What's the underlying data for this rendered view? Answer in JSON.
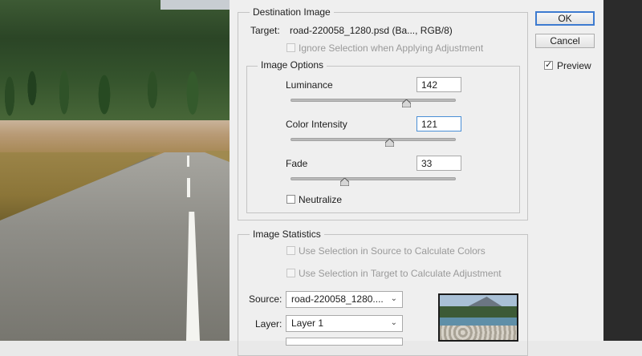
{
  "destination": {
    "group_title": "Destination Image",
    "target_label": "Target:",
    "target_value": "road-220058_1280.psd (Ba..., RGB/8)",
    "ignore_selection_label": "Ignore Selection when Applying Adjustment"
  },
  "image_options": {
    "group_title": "Image Options",
    "luminance": {
      "label": "Luminance",
      "value": "142",
      "slider_fraction": 0.7
    },
    "color_intensity": {
      "label": "Color Intensity",
      "value": "121",
      "slider_fraction": 0.6
    },
    "fade": {
      "label": "Fade",
      "value": "33",
      "slider_fraction": 0.33
    },
    "neutralize_label": "Neutralize"
  },
  "image_statistics": {
    "group_title": "Image Statistics",
    "use_source_label": "Use Selection in Source to Calculate Colors",
    "use_target_label": "Use Selection in Target to Calculate Adjustment",
    "source_label": "Source:",
    "source_value": "road-220058_1280....",
    "layer_label": "Layer:",
    "layer_value": "Layer 1"
  },
  "buttons": {
    "ok": "OK",
    "cancel": "Cancel",
    "preview_label": "Preview",
    "preview_checked": true
  },
  "icons": {
    "dropdown": "chevron-down-icon",
    "slider_thumb": "slider-triangle-icon",
    "check": "checkmark-icon"
  },
  "colors": {
    "focus_border": "#4a8fd6",
    "default_button_border": "#3d7bd0",
    "dialog_background": "#efefef"
  }
}
